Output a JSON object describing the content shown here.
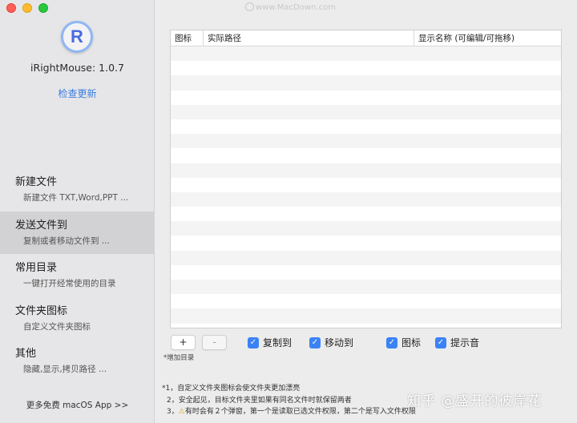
{
  "window": {
    "title": "iRightMouse"
  },
  "sidebar": {
    "app_name": "iRightMouse: 1.0.7",
    "app_icon_letter": "R",
    "update_link": "检查更新",
    "items": [
      {
        "title": "新建文件",
        "subtitle": "新建文件 TXT,Word,PPT ..."
      },
      {
        "title": "发送文件到",
        "subtitle": "复制或者移动文件到 ..."
      },
      {
        "title": "常用目录",
        "subtitle": "一键打开经常使用的目录"
      },
      {
        "title": "文件夹图标",
        "subtitle": "自定义文件夹图标"
      },
      {
        "title": "其他",
        "subtitle": "隐藏,显示,拷贝路径 ..."
      }
    ],
    "active_index": 1,
    "more_apps": "更多免费 macOS App >>"
  },
  "main": {
    "watermark": "www.MacDown.com",
    "table": {
      "columns": [
        "图标",
        "实际路径",
        "显示名称 (可编辑/可拖移)"
      ],
      "rows": []
    },
    "add_button": "+",
    "remove_button": "-",
    "add_hint": "*增加目录",
    "checkboxes": [
      {
        "label": "复制到",
        "checked": true
      },
      {
        "label": "移动到",
        "checked": true
      },
      {
        "label": "图标",
        "checked": true
      },
      {
        "label": "提示音",
        "checked": true
      }
    ],
    "notes": [
      "*1，自定义文件夹图标会使文件夹更加漂亮",
      "2，安全起见，目标文件夹里如果有同名文件时就保留两者",
      "3，",
      "有时会有２个弹窗，第一个是读取已选文件权限，第二个是写入文件权限"
    ],
    "overlay_text": "知乎 @盛开的彼岸花"
  },
  "colors": {
    "accent": "#3b82f6",
    "link": "#3a7de0",
    "sidebar_bg": "#e6e6e8",
    "active_bg": "#d2d2d4"
  }
}
